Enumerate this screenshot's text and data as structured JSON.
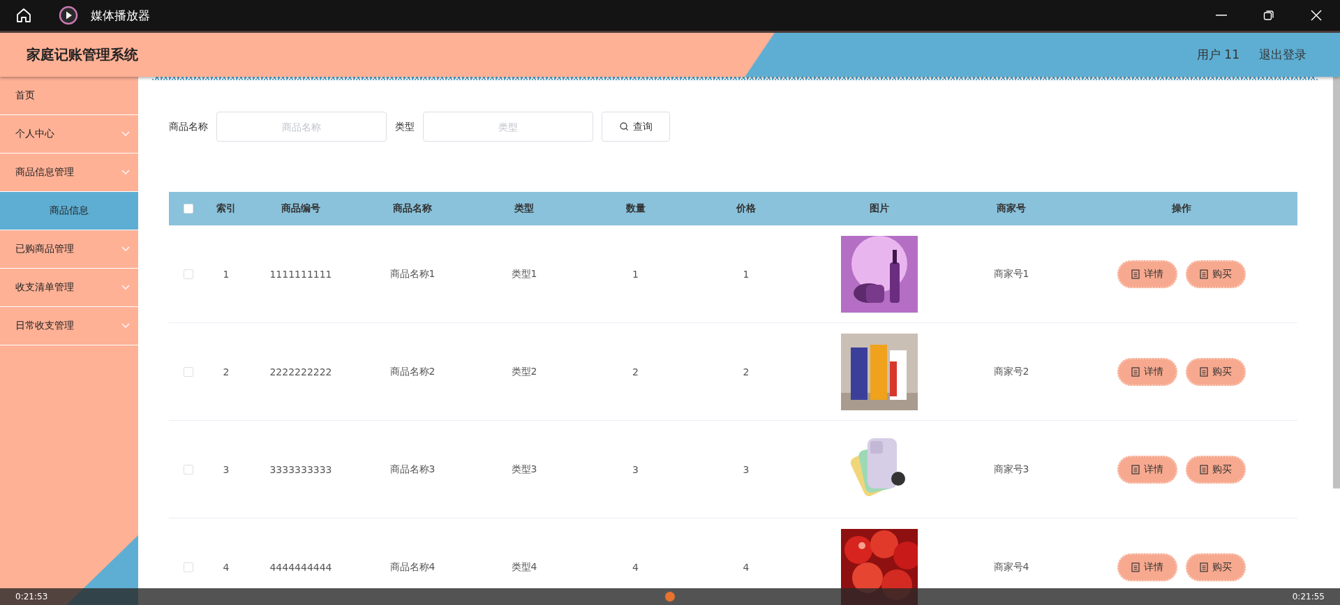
{
  "window": {
    "title": "媒体播放器"
  },
  "header": {
    "title": "家庭记账管理系统",
    "user": "用户 11",
    "logout": "退出登录"
  },
  "sidebar": {
    "items": [
      {
        "label": "首页",
        "kind": "link"
      },
      {
        "label": "个人中心",
        "kind": "submenu"
      },
      {
        "label": "商品信息管理",
        "kind": "submenu",
        "children": [
          {
            "label": "商品信息",
            "selected": true
          }
        ]
      },
      {
        "label": "已购商品管理",
        "kind": "submenu"
      },
      {
        "label": "收支清单管理",
        "kind": "submenu"
      },
      {
        "label": "日常收支管理",
        "kind": "submenu"
      }
    ]
  },
  "search": {
    "fields": [
      {
        "label": "商品名称",
        "placeholder": "商品名称"
      },
      {
        "label": "类型",
        "placeholder": "类型"
      }
    ],
    "button": "查询"
  },
  "table": {
    "select_all": {
      "checked": false
    },
    "columns": [
      "索引",
      "商品编号",
      "商品名称",
      "类型",
      "数量",
      "价格",
      "图片",
      "商家号",
      "操作"
    ],
    "rows": [
      {
        "checked": false,
        "cells": [
          "1",
          "1111111111",
          "商品名称1",
          "类型1",
          "1",
          "1"
        ],
        "merchant": "商家号1",
        "actions": [
          "详情",
          "购买"
        ]
      },
      {
        "checked": false,
        "cells": [
          "2",
          "2222222222",
          "商品名称2",
          "类型2",
          "2",
          "2"
        ],
        "merchant": "商家号2",
        "actions": [
          "详情",
          "购买"
        ]
      },
      {
        "checked": false,
        "cells": [
          "3",
          "3333333333",
          "商品名称3",
          "类型3",
          "3",
          "3"
        ],
        "merchant": "商家号3",
        "actions": [
          "详情",
          "购买"
        ]
      },
      {
        "checked": false,
        "cells": [
          "4",
          "4444444444",
          "商品名称4",
          "类型4",
          "4",
          "4"
        ],
        "merchant": "商家号4",
        "actions": [
          "详情",
          "购买"
        ]
      }
    ]
  },
  "player": {
    "elapsed": "0:21:53",
    "total": "0:21:55"
  }
}
